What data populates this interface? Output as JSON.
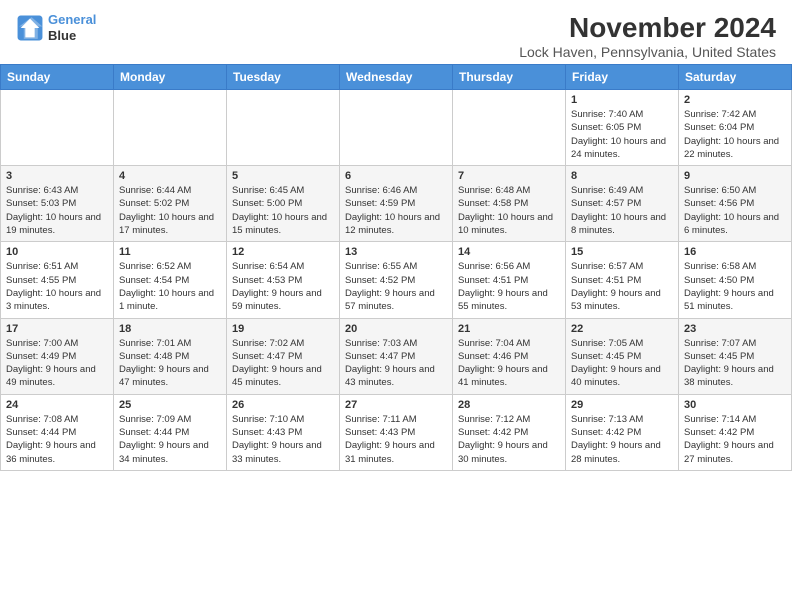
{
  "app": {
    "name": "GeneralBlue",
    "logo_text_1": "General",
    "logo_text_2": "Blue"
  },
  "header": {
    "month_year": "November 2024",
    "location": "Lock Haven, Pennsylvania, United States"
  },
  "days_of_week": [
    "Sunday",
    "Monday",
    "Tuesday",
    "Wednesday",
    "Thursday",
    "Friday",
    "Saturday"
  ],
  "weeks": [
    {
      "days": [
        {
          "num": "",
          "info": ""
        },
        {
          "num": "",
          "info": ""
        },
        {
          "num": "",
          "info": ""
        },
        {
          "num": "",
          "info": ""
        },
        {
          "num": "",
          "info": ""
        },
        {
          "num": "1",
          "info": "Sunrise: 7:40 AM\nSunset: 6:05 PM\nDaylight: 10 hours and 24 minutes."
        },
        {
          "num": "2",
          "info": "Sunrise: 7:42 AM\nSunset: 6:04 PM\nDaylight: 10 hours and 22 minutes."
        }
      ]
    },
    {
      "days": [
        {
          "num": "3",
          "info": "Sunrise: 6:43 AM\nSunset: 5:03 PM\nDaylight: 10 hours and 19 minutes."
        },
        {
          "num": "4",
          "info": "Sunrise: 6:44 AM\nSunset: 5:02 PM\nDaylight: 10 hours and 17 minutes."
        },
        {
          "num": "5",
          "info": "Sunrise: 6:45 AM\nSunset: 5:00 PM\nDaylight: 10 hours and 15 minutes."
        },
        {
          "num": "6",
          "info": "Sunrise: 6:46 AM\nSunset: 4:59 PM\nDaylight: 10 hours and 12 minutes."
        },
        {
          "num": "7",
          "info": "Sunrise: 6:48 AM\nSunset: 4:58 PM\nDaylight: 10 hours and 10 minutes."
        },
        {
          "num": "8",
          "info": "Sunrise: 6:49 AM\nSunset: 4:57 PM\nDaylight: 10 hours and 8 minutes."
        },
        {
          "num": "9",
          "info": "Sunrise: 6:50 AM\nSunset: 4:56 PM\nDaylight: 10 hours and 6 minutes."
        }
      ]
    },
    {
      "days": [
        {
          "num": "10",
          "info": "Sunrise: 6:51 AM\nSunset: 4:55 PM\nDaylight: 10 hours and 3 minutes."
        },
        {
          "num": "11",
          "info": "Sunrise: 6:52 AM\nSunset: 4:54 PM\nDaylight: 10 hours and 1 minute."
        },
        {
          "num": "12",
          "info": "Sunrise: 6:54 AM\nSunset: 4:53 PM\nDaylight: 9 hours and 59 minutes."
        },
        {
          "num": "13",
          "info": "Sunrise: 6:55 AM\nSunset: 4:52 PM\nDaylight: 9 hours and 57 minutes."
        },
        {
          "num": "14",
          "info": "Sunrise: 6:56 AM\nSunset: 4:51 PM\nDaylight: 9 hours and 55 minutes."
        },
        {
          "num": "15",
          "info": "Sunrise: 6:57 AM\nSunset: 4:51 PM\nDaylight: 9 hours and 53 minutes."
        },
        {
          "num": "16",
          "info": "Sunrise: 6:58 AM\nSunset: 4:50 PM\nDaylight: 9 hours and 51 minutes."
        }
      ]
    },
    {
      "days": [
        {
          "num": "17",
          "info": "Sunrise: 7:00 AM\nSunset: 4:49 PM\nDaylight: 9 hours and 49 minutes."
        },
        {
          "num": "18",
          "info": "Sunrise: 7:01 AM\nSunset: 4:48 PM\nDaylight: 9 hours and 47 minutes."
        },
        {
          "num": "19",
          "info": "Sunrise: 7:02 AM\nSunset: 4:47 PM\nDaylight: 9 hours and 45 minutes."
        },
        {
          "num": "20",
          "info": "Sunrise: 7:03 AM\nSunset: 4:47 PM\nDaylight: 9 hours and 43 minutes."
        },
        {
          "num": "21",
          "info": "Sunrise: 7:04 AM\nSunset: 4:46 PM\nDaylight: 9 hours and 41 minutes."
        },
        {
          "num": "22",
          "info": "Sunrise: 7:05 AM\nSunset: 4:45 PM\nDaylight: 9 hours and 40 minutes."
        },
        {
          "num": "23",
          "info": "Sunrise: 7:07 AM\nSunset: 4:45 PM\nDaylight: 9 hours and 38 minutes."
        }
      ]
    },
    {
      "days": [
        {
          "num": "24",
          "info": "Sunrise: 7:08 AM\nSunset: 4:44 PM\nDaylight: 9 hours and 36 minutes."
        },
        {
          "num": "25",
          "info": "Sunrise: 7:09 AM\nSunset: 4:44 PM\nDaylight: 9 hours and 34 minutes."
        },
        {
          "num": "26",
          "info": "Sunrise: 7:10 AM\nSunset: 4:43 PM\nDaylight: 9 hours and 33 minutes."
        },
        {
          "num": "27",
          "info": "Sunrise: 7:11 AM\nSunset: 4:43 PM\nDaylight: 9 hours and 31 minutes."
        },
        {
          "num": "28",
          "info": "Sunrise: 7:12 AM\nSunset: 4:42 PM\nDaylight: 9 hours and 30 minutes."
        },
        {
          "num": "29",
          "info": "Sunrise: 7:13 AM\nSunset: 4:42 PM\nDaylight: 9 hours and 28 minutes."
        },
        {
          "num": "30",
          "info": "Sunrise: 7:14 AM\nSunset: 4:42 PM\nDaylight: 9 hours and 27 minutes."
        }
      ]
    }
  ]
}
